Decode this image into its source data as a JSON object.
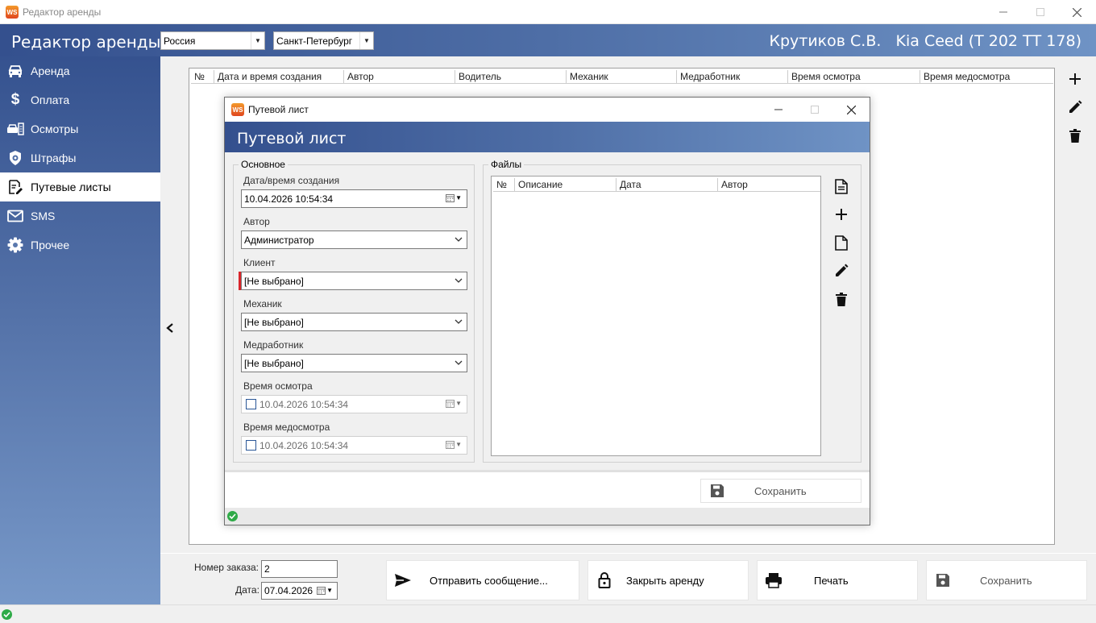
{
  "window": {
    "title": "Редактор аренды",
    "logo": "WS"
  },
  "header": {
    "title": "Редактор аренды",
    "country": "Россия",
    "city": "Санкт-Петербург",
    "user": "Крутиков С.В.",
    "car": "Kia Ceed (Т 202 ТТ 178)"
  },
  "sidebar": {
    "items": [
      {
        "label": "Аренда",
        "icon": "car-icon"
      },
      {
        "label": "Оплата",
        "icon": "dollar-icon"
      },
      {
        "label": "Осмотры",
        "icon": "inspection-icon"
      },
      {
        "label": "Штрафы",
        "icon": "shield-icon"
      },
      {
        "label": "Путевые листы",
        "icon": "edit-document-icon"
      },
      {
        "label": "SMS",
        "icon": "mail-icon"
      },
      {
        "label": "Прочее",
        "icon": "gear-icon"
      }
    ],
    "active": "Путевые листы"
  },
  "main_grid": {
    "columns": [
      "№",
      "Дата и время создания",
      "Автор",
      "Водитель",
      "Механик",
      "Медработник",
      "Время осмотра",
      "Время медосмотра"
    ]
  },
  "dialog": {
    "title": "Путевой лист",
    "header": "Путевой лист",
    "basic": {
      "title": "Основное",
      "created_label": "Дата/время создания",
      "created_value": "10.04.2026 10:54:34",
      "author_label": "Автор",
      "author_value": "Администратор",
      "client_label": "Клиент",
      "client_value": "[Не выбрано]",
      "mechanic_label": "Механик",
      "mechanic_value": "[Не выбрано]",
      "medic_label": "Медработник",
      "medic_value": "[Не выбрано]",
      "inspection_label": "Время осмотра",
      "inspection_value": "10.04.2026 10:54:34",
      "medcheck_label": "Время медосмотра",
      "medcheck_value": "10.04.2026 10:54:34"
    },
    "files": {
      "title": "Файлы",
      "columns": [
        "№",
        "Описание",
        "Дата",
        "Автор"
      ]
    },
    "save_label": "Сохранить"
  },
  "bottom": {
    "order_label": "Номер заказа:",
    "order_value": "2",
    "date_label": "Дата:",
    "date_value": "07.04.2026",
    "send_label": "Отправить сообщение...",
    "close_label": "Закрыть аренду",
    "print_label": "Печать",
    "save_label": "Сохранить"
  },
  "colors": {
    "accent": "#34508e",
    "required": "#d9262b",
    "ok": "#2eaa47"
  }
}
